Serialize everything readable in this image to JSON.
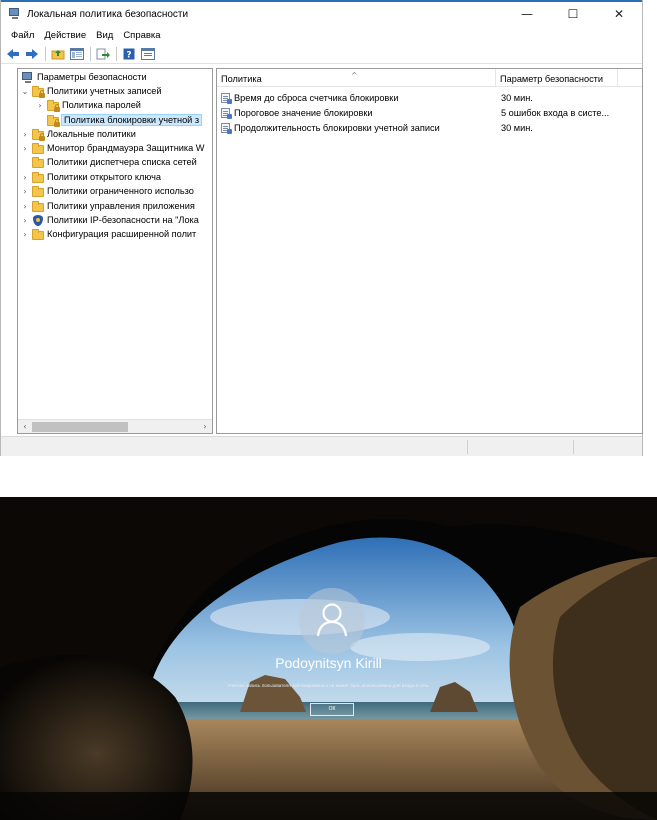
{
  "window": {
    "title": "Локальная политика безопасности",
    "controls": {
      "minimize": "—",
      "maximize": "☐",
      "close": "✕"
    }
  },
  "menu": [
    "Файл",
    "Действие",
    "Вид",
    "Справка"
  ],
  "tree": {
    "items": [
      {
        "label": "Параметры безопасности",
        "chevron": "",
        "icon": "computer-icon"
      },
      {
        "label": "Политики учетных записей",
        "chevron": "⌄",
        "icon": "folder-lock-icon"
      },
      {
        "label": "Политика паролей",
        "chevron": "›",
        "icon": "folder-lock-icon"
      },
      {
        "label": "Политика блокировки учетной з",
        "chevron": "",
        "icon": "folder-lock-icon",
        "selected": true
      },
      {
        "label": "Локальные политики",
        "chevron": "›",
        "icon": "folder-lock-icon"
      },
      {
        "label": "Монитор брандмауэра Защитника W",
        "chevron": "›",
        "icon": "folder-icon"
      },
      {
        "label": "Политики диспетчера списка сетей",
        "chevron": "",
        "icon": "folder-icon"
      },
      {
        "label": "Политики открытого ключа",
        "chevron": "›",
        "icon": "folder-icon"
      },
      {
        "label": "Политики ограниченного использо",
        "chevron": "›",
        "icon": "folder-icon"
      },
      {
        "label": "Политики управления приложения",
        "chevron": "›",
        "icon": "folder-icon"
      },
      {
        "label": "Политики IP-безопасности на \"Лока",
        "chevron": "›",
        "icon": "shield-icon"
      },
      {
        "label": "Конфигурация расширенной полит",
        "chevron": "›",
        "icon": "folder-icon"
      }
    ],
    "scroll_left": "‹",
    "scroll_right": "›"
  },
  "list": {
    "columns": [
      "Политика",
      "Параметр безопасности"
    ],
    "sort_indicator": "^",
    "rows": [
      {
        "policy": "Время до сброса счетчика блокировки",
        "value": "30 мин."
      },
      {
        "policy": "Пороговое значение блокировки",
        "value": "5 ошибок входа в систе..."
      },
      {
        "policy": "Продолжительность блокировки учетной записи",
        "value": "30 мин."
      }
    ]
  },
  "lockscreen": {
    "username": "Podoynitsyn Kirill",
    "message": "Учетная запись пользователя заблокирована и не может быть использована для входа в сеть.",
    "ok_label": "ОК"
  }
}
